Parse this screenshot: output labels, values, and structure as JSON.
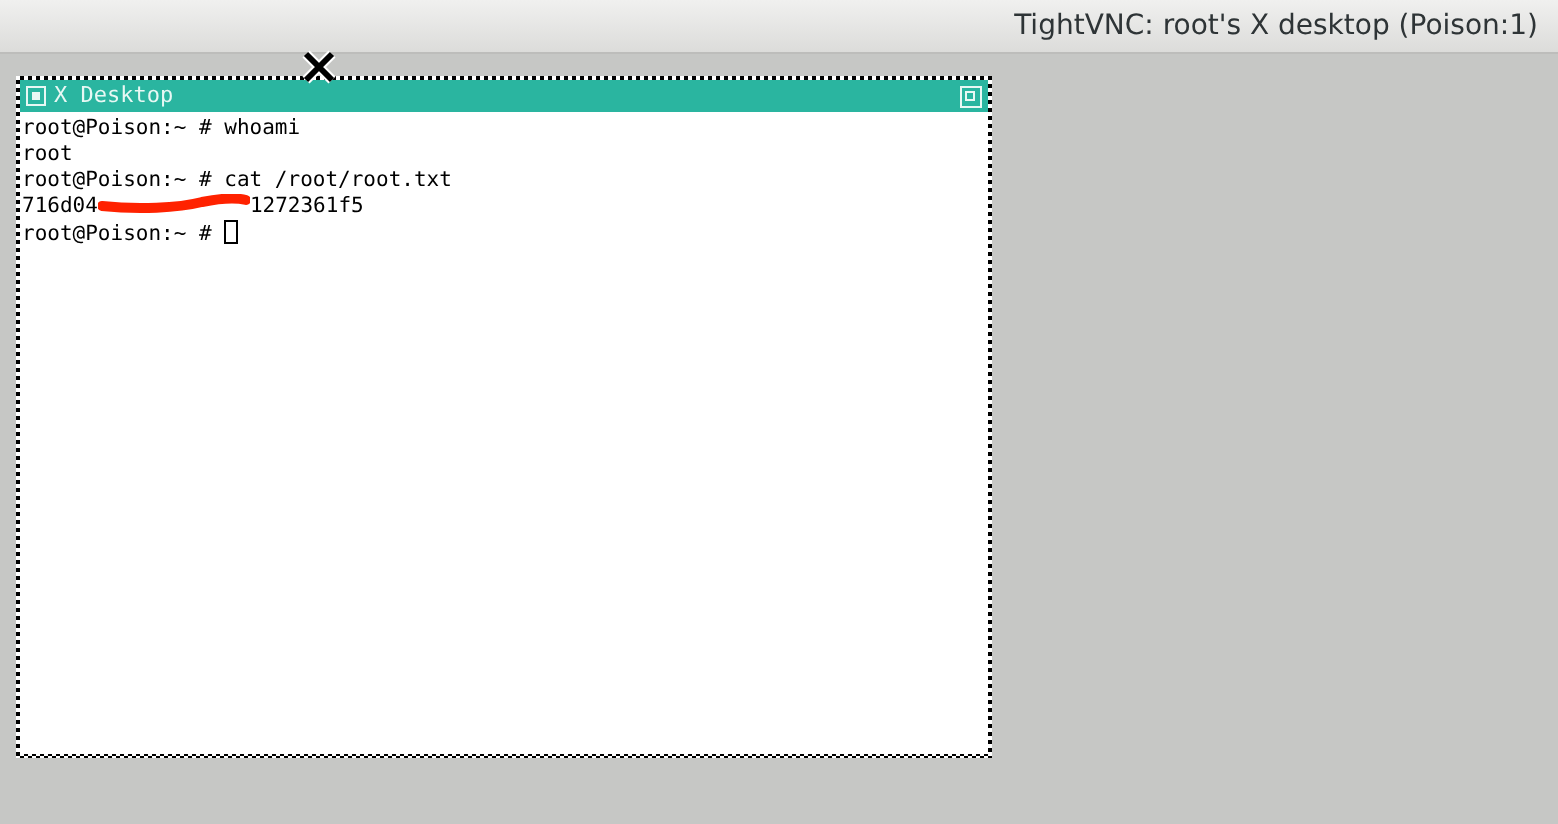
{
  "window": {
    "title": "TightVNC: root's X desktop (Poison:1)"
  },
  "xterm": {
    "title": "X Desktop",
    "lines": [
      {
        "kind": "text",
        "text": "root@Poison:~ # whoami"
      },
      {
        "kind": "text",
        "text": "root"
      },
      {
        "kind": "text",
        "text": "root@Poison:~ # cat /root/root.txt"
      },
      {
        "kind": "redacted",
        "before": "716d04",
        "after": "1272361f5"
      },
      {
        "kind": "prompt",
        "text": "root@Poison:~ # "
      }
    ]
  }
}
